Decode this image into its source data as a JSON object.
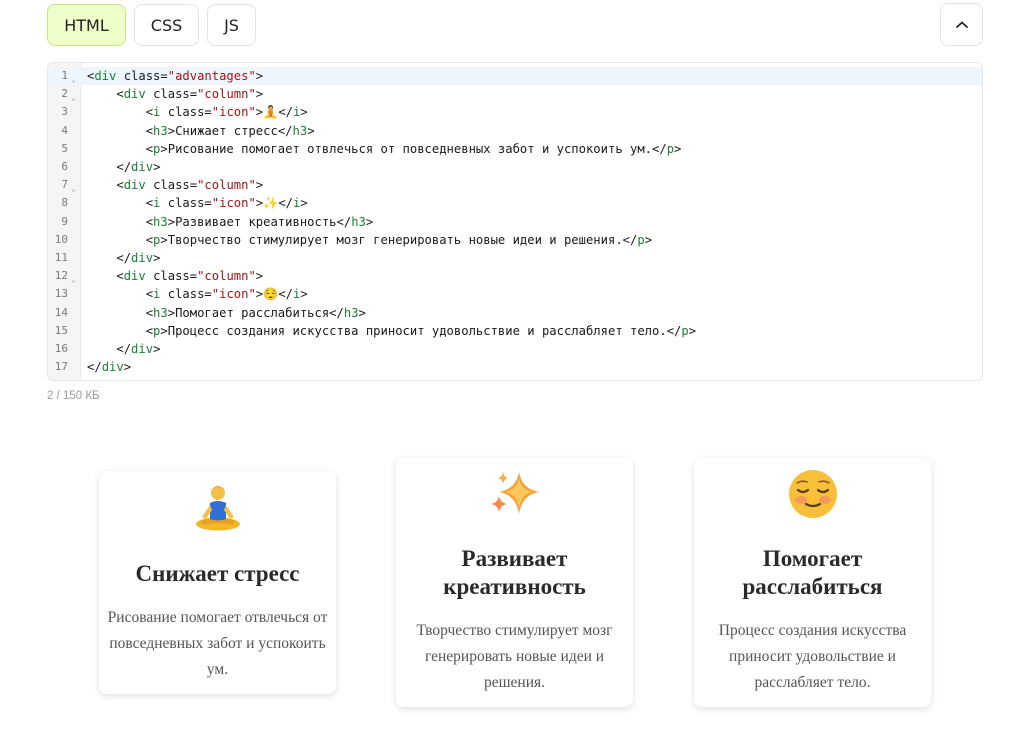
{
  "tabs": [
    {
      "label": "HTML",
      "active": true
    },
    {
      "label": "CSS",
      "active": false
    },
    {
      "label": "JS",
      "active": false
    }
  ],
  "icons": {
    "collapse": "chevron-up-icon",
    "fold": "chevron-down-icon"
  },
  "code": {
    "line_numbers": [
      "1",
      "2",
      "3",
      "4",
      "5",
      "6",
      "7",
      "8",
      "9",
      "10",
      "11",
      "12",
      "13",
      "14",
      "15",
      "16",
      "17"
    ],
    "lines": [
      "<div class=\"advantages\">",
      "    <div class=\"column\">",
      "        <i class=\"icon\">🧘</i>",
      "        <h3>Снижает стресс</h3>",
      "        <p>Рисование помогает отвлечься от повседневных забот и успокоить ум.</p>",
      "    </div>",
      "    <div class=\"column\">",
      "        <i class=\"icon\">✨</i>",
      "        <h3>Развивает креативность</h3>",
      "        <p>Творчество стимулирует мозг генерировать новые идеи и решения.</p>",
      "    </div>",
      "    <div class=\"column\">",
      "        <i class=\"icon\">😌</i>",
      "        <h3>Помогает расслабиться</h3>",
      "        <p>Процесс создания искусства приносит удовольствие и расслабляет тело.</p>",
      "    </div>",
      "</div>"
    ]
  },
  "size_info": "2 / 150 КБ",
  "cards": [
    {
      "icon": "meditation-emoji-icon",
      "title": "Снижает стресс",
      "text": "Рисование помогает отвлечься от повседневных забот и успокоить ум."
    },
    {
      "icon": "sparkles-emoji-icon",
      "title": "Развивает креативность",
      "text": "Творчество стимулирует мозг генерировать новые идеи и решения."
    },
    {
      "icon": "relieved-face-emoji-icon",
      "title": "Помогает расслабиться",
      "text": "Процесс создания искусства приносит удовольствие и расслабляет тело."
    }
  ],
  "colors": {
    "active_tab_bg": "#efffc9",
    "active_tab_border": "#c4e67e",
    "tag": "#1a7f37",
    "string": "#a31515"
  }
}
